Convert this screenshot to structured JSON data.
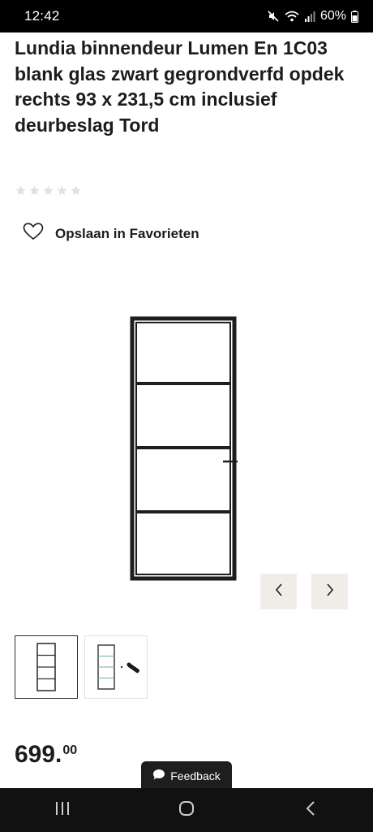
{
  "status_bar": {
    "time": "12:42",
    "battery": "60%",
    "icons": [
      "mute-icon",
      "wifi-icon",
      "signal-icon",
      "battery-icon"
    ]
  },
  "product": {
    "title": "Lundia binnendeur Lumen En 1C03 blank glas zwart gegrondverfd opdek rechts 93 x 231,5 cm inclusief deurbeslag Tord",
    "rating_stars": 5,
    "rating_value": 0,
    "favorite_label": "Opslaan in Favorieten",
    "price_main": "699.",
    "price_cents": "00"
  },
  "gallery": {
    "thumbnail_count": 2,
    "selected_index": 0,
    "prev_icon": "chevron-left-icon",
    "next_icon": "chevron-right-icon"
  },
  "feedback": {
    "label": "Feedback",
    "icon": "speech-bubble-icon"
  },
  "system_nav": {
    "icons": [
      "recent-apps-icon",
      "home-icon",
      "back-icon"
    ]
  },
  "colors": {
    "button_bg": "#f0ece8",
    "star_empty": "#e2e2e2",
    "door_frame": "#1e1e1e"
  }
}
